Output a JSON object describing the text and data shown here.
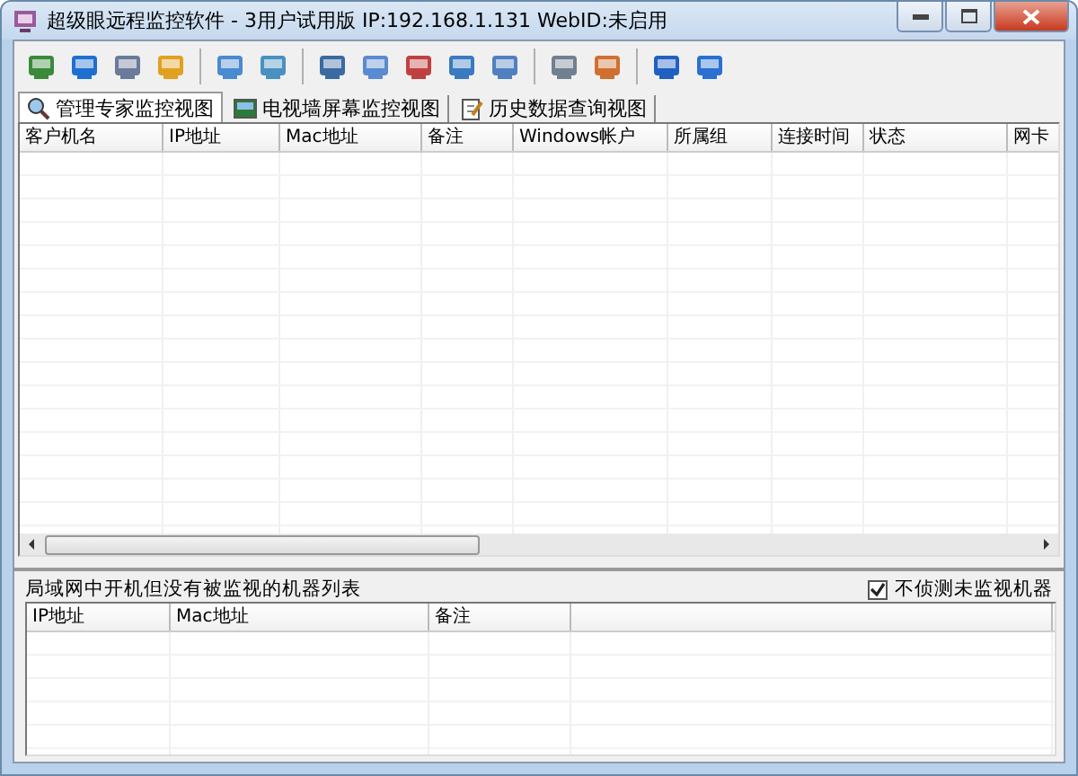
{
  "window": {
    "title": "超级眼远程监控软件 - 3用户试用版 IP:192.168.1.131 WebID:未启用"
  },
  "tabs": [
    {
      "label": "管理专家监控视图",
      "selected": true,
      "kind": "magnifier"
    },
    {
      "label": "电视墙屏幕监控视图",
      "selected": false,
      "kind": "picture"
    },
    {
      "label": "历史数据查询视图",
      "selected": false,
      "kind": "notepad"
    }
  ],
  "table": {
    "columns": [
      {
        "label": "客户机名"
      },
      {
        "label": "IP地址"
      },
      {
        "label": "Mac地址"
      },
      {
        "label": "备注"
      },
      {
        "label": "Windows帐户"
      },
      {
        "label": "所属组"
      },
      {
        "label": "连接时间"
      },
      {
        "label": "状态"
      },
      {
        "label": "网卡"
      }
    ]
  },
  "lan_panel": {
    "title": "局域网中开机但没有被监视的机器列表",
    "checkbox": {
      "label": "不侦测未监视机器",
      "checked": true
    },
    "columns": [
      {
        "label": "IP地址"
      },
      {
        "label": "Mac地址"
      },
      {
        "label": "备注"
      },
      {}
    ]
  }
}
